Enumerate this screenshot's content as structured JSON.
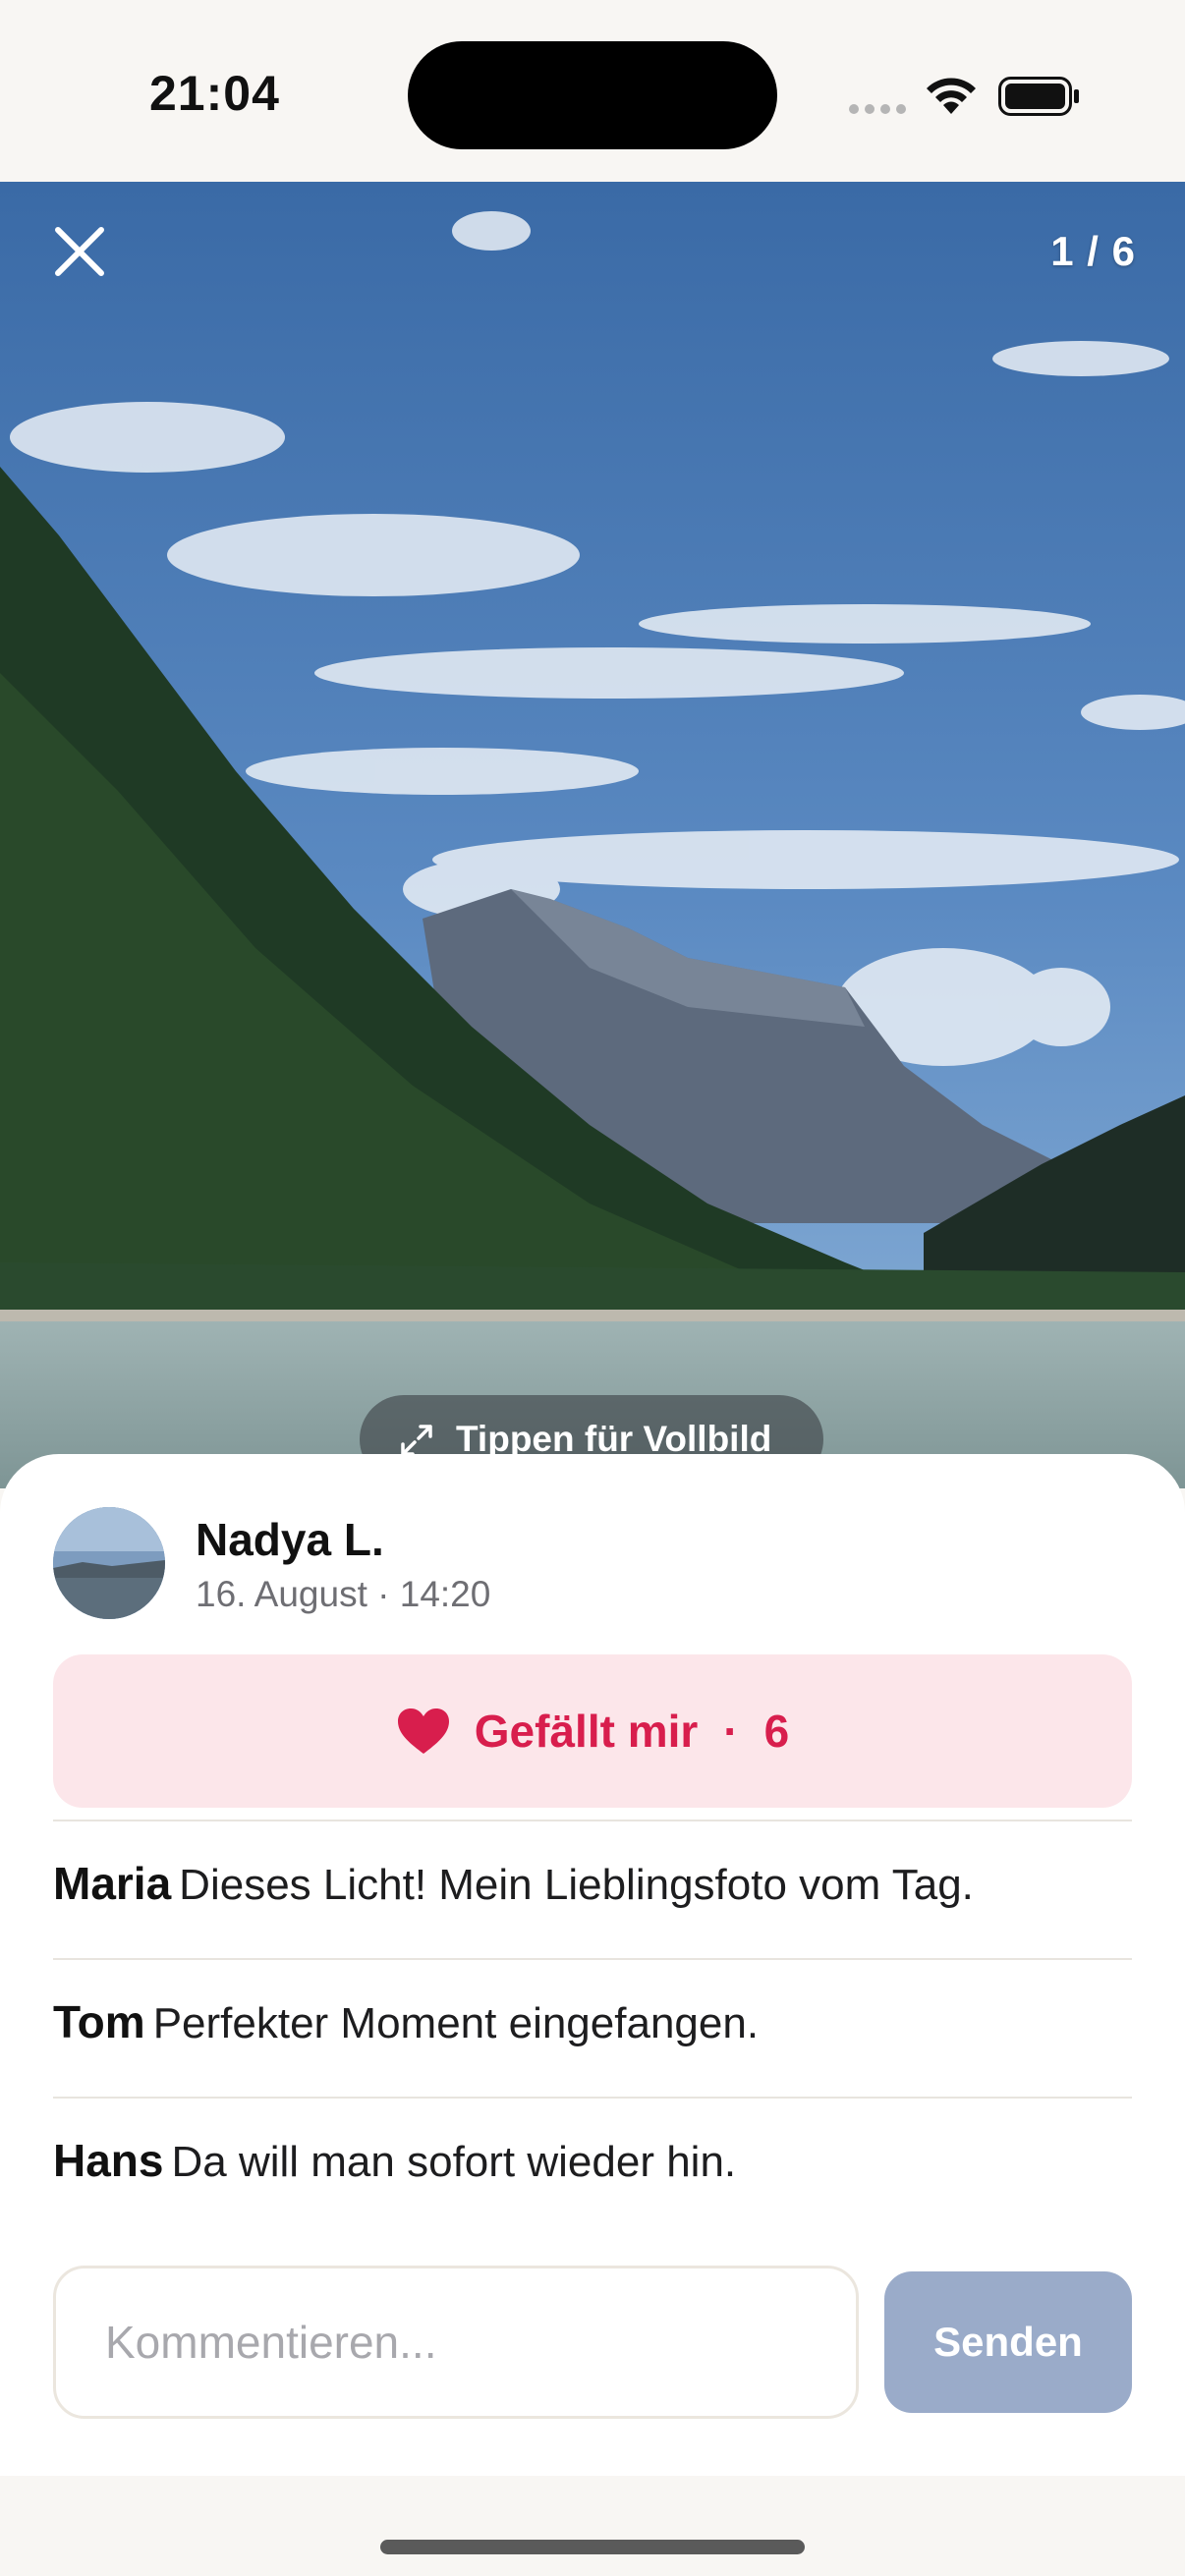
{
  "status_bar": {
    "time": "21:04"
  },
  "viewer": {
    "counter": "1 / 6",
    "fullscreen_hint": "Tippen für Vollbild"
  },
  "post": {
    "author": "Nadya L.",
    "meta": "16. August · 14:20",
    "like_label": "Gefällt mir",
    "like_separator": "·",
    "like_count": "6",
    "accent_color": "#d81e4d"
  },
  "comments": [
    {
      "author": "Maria",
      "text": "Dieses Licht! Mein Lieblingsfoto vom Tag."
    },
    {
      "author": "Tom",
      "text": "Perfekter Moment eingefangen."
    },
    {
      "author": "Hans",
      "text": "Da will man sofort wieder hin."
    }
  ],
  "composer": {
    "placeholder": "Kommentieren...",
    "send_label": "Senden"
  },
  "icons": [
    "close-icon",
    "expand-icon",
    "heart-icon",
    "wifi-icon",
    "battery-icon",
    "signal-icon"
  ]
}
